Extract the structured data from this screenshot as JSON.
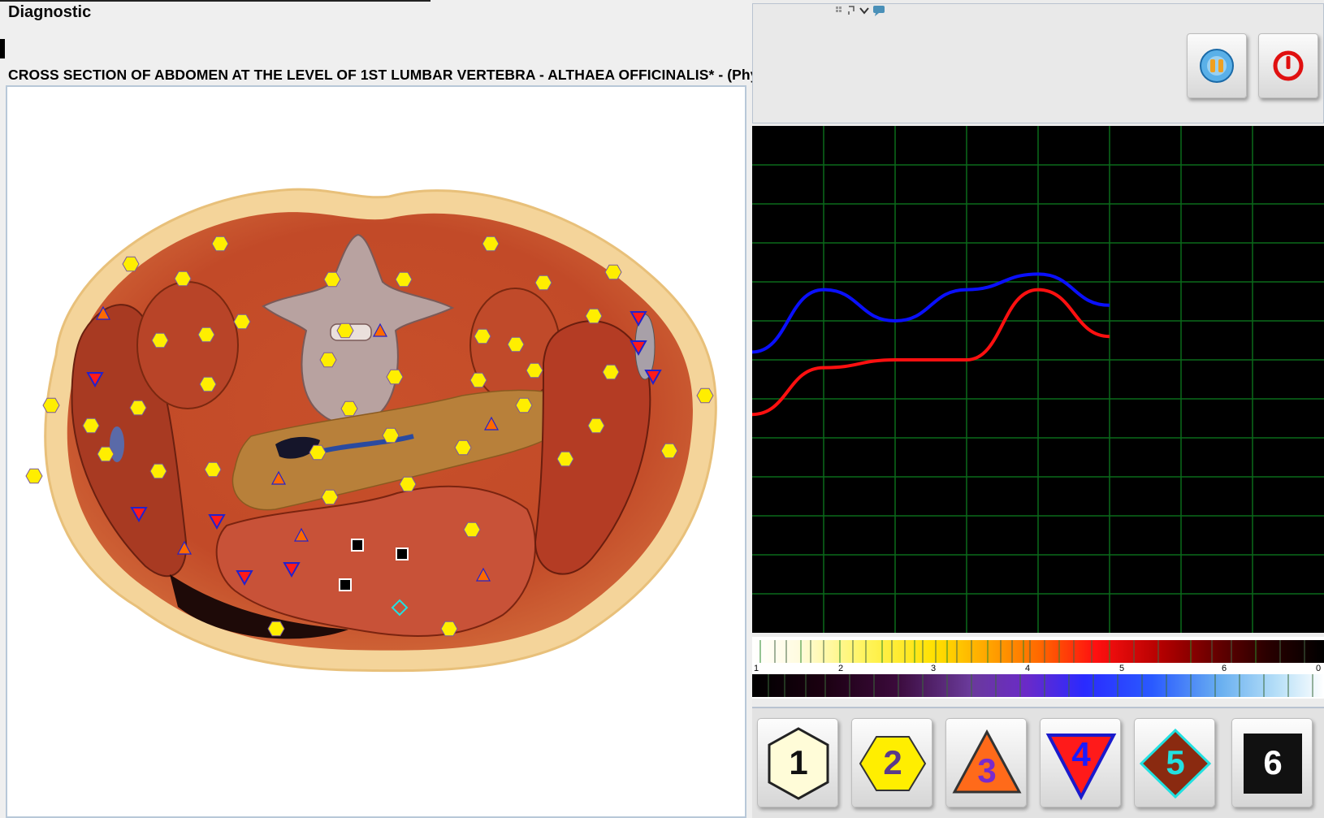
{
  "app": {
    "title": "Diagnostic"
  },
  "section": {
    "title": "CROSS SECTION OF ABDOMEN AT THE LEVEL OF 1ST LUMBAR VERTEBRA - ALTHAEA  OFFICINALIS* - (Phytotherapy)"
  },
  "toolbar": {
    "media_icon": "media-disc-icon",
    "power_icon": "power-icon",
    "window_icons": [
      "grid-icon",
      "expand-icon",
      "chevron-down-icon",
      "chat-icon"
    ]
  },
  "colors": {
    "marker_yellow": "#ffee00",
    "marker_outline": "#7a5a9a",
    "triangle_up_fill": "#ff6a00",
    "triangle_down_fill": "#ff1a1a",
    "triangle_outline": "#2222cc",
    "series_blue": "#0a10ff",
    "series_red": "#ff1010",
    "grid_green": "#0a6a1a"
  },
  "chart_data": {
    "type": "line",
    "x": [
      0,
      1,
      2,
      3,
      4,
      5
    ],
    "xlim": [
      0,
      8
    ],
    "ylim": [
      0,
      6.5
    ],
    "grid": true,
    "series": [
      {
        "values": [
          3.6,
          4.4,
          4.0,
          4.4,
          4.6,
          4.2
        ],
        "color": "#0a10ff"
      },
      {
        "values": [
          2.8,
          3.4,
          3.5,
          3.5,
          4.4,
          3.8
        ],
        "color": "#ff1010"
      }
    ]
  },
  "scale": {
    "labels": [
      "1",
      "2",
      "3",
      "4",
      "5",
      "6",
      "0"
    ]
  },
  "levels": [
    {
      "label": "1",
      "shape": "hexagon",
      "fill": "#fffcd8",
      "text_color": "#111"
    },
    {
      "label": "2",
      "shape": "hexagon",
      "fill": "#ffee00",
      "text_color": "#5a3a8a"
    },
    {
      "label": "3",
      "shape": "triangle-up",
      "fill": "#ff6a1a",
      "text_color": "#7a2acc"
    },
    {
      "label": "4",
      "shape": "triangle-down",
      "fill": "#ff1a1a",
      "text_color": "#1a1aff"
    },
    {
      "label": "5",
      "shape": "diamond",
      "fill": "#8a2a10",
      "text_color": "#22e0e0"
    },
    {
      "label": "6",
      "shape": "square",
      "fill": "#111111",
      "text_color": "#ffffff"
    }
  ]
}
